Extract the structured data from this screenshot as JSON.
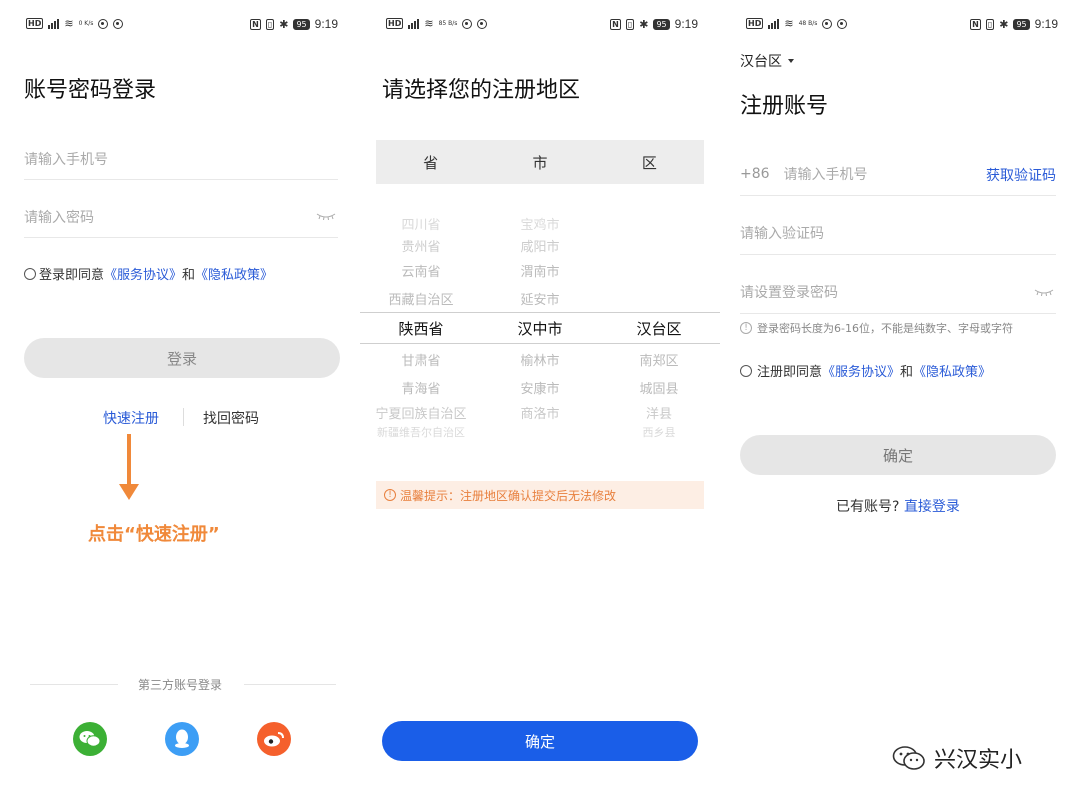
{
  "status": {
    "panel1_speed": "0 K/s",
    "panel2_speed": "85 B/s",
    "panel3_speed": "48 B/s",
    "battery": "95",
    "time": "9:19"
  },
  "login": {
    "title": "账号密码登录",
    "phone_placeholder": "请输入手机号",
    "password_placeholder": "请输入密码",
    "agree_prefix": "登录即同意",
    "service_link": "《服务协议》",
    "and": "和",
    "privacy_link": "《隐私政策》",
    "login_button": "登录",
    "quick_register": "快速注册",
    "find_password": "找回密码",
    "annotation": "点击“快速注册”",
    "third_party_label": "第三方账号登录",
    "social": [
      "wechat-icon",
      "qq-icon",
      "weibo-icon"
    ]
  },
  "region_picker": {
    "title": "请选择您的注册地区",
    "headers": [
      "省",
      "市",
      "区"
    ],
    "provinces": [
      "四川省",
      "贵州省",
      "云南省",
      "西藏自治区",
      "陕西省",
      "甘肃省",
      "青海省",
      "宁夏回族自治区",
      "新疆维吾尔自治区"
    ],
    "cities": [
      "宝鸡市",
      "咸阳市",
      "渭南市",
      "延安市",
      "汉中市",
      "榆林市",
      "安康市",
      "商洛市"
    ],
    "districts": [
      "汉台区",
      "南郑区",
      "城固县",
      "洋县",
      "西乡县"
    ],
    "selected": {
      "province": "陕西省",
      "city": "汉中市",
      "district": "汉台区"
    },
    "tip": "温馨提示：注册地区确认提交后无法修改",
    "confirm": "确定"
  },
  "register": {
    "region": "汉台区",
    "title": "注册账号",
    "country_code": "+86",
    "phone_placeholder": "请输入手机号",
    "get_code": "获取验证码",
    "code_placeholder": "请输入验证码",
    "password_placeholder": "请设置登录密码",
    "password_hint": "登录密码长度为6-16位，不能是纯数字、字母或字符",
    "agree_prefix": "注册即同意",
    "service_link": "《服务协议》",
    "and": "和",
    "privacy_link": "《隐私政策》",
    "confirm": "确定",
    "have_account": "已有账号?",
    "direct_login": "直接登录"
  },
  "watermark": "兴汉实小",
  "colors": {
    "link": "#2a5bd7",
    "orange": "#f0893a",
    "primary_blue": "#1a5ee8",
    "wechat": "#3cb035",
    "qq": "#3d9ef5",
    "weibo": "#f5602c"
  }
}
